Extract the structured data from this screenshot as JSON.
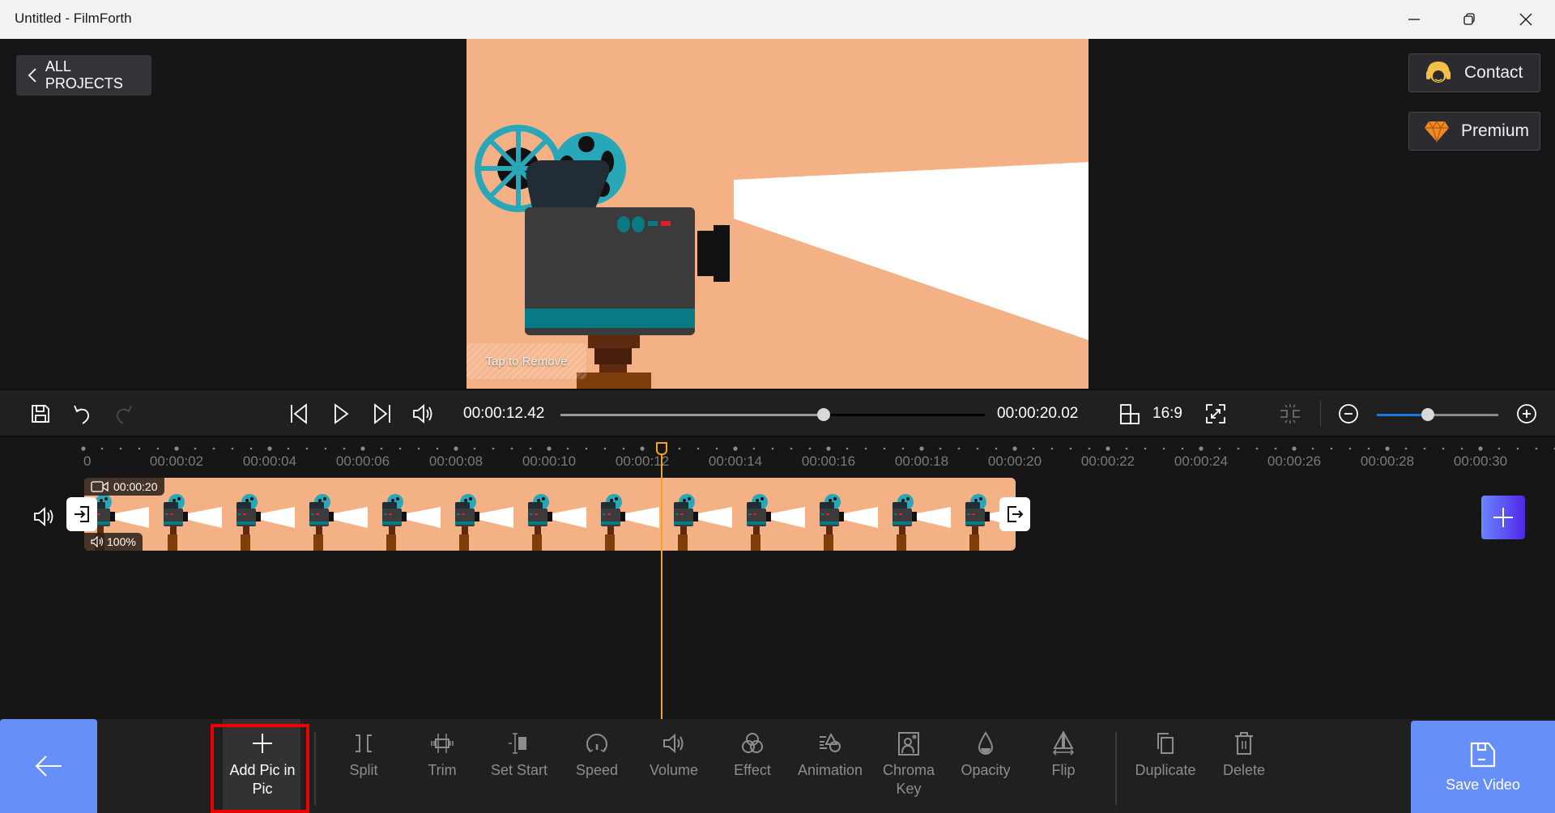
{
  "window": {
    "title": "Untitled - FilmForth",
    "controls": [
      "minimize-icon",
      "restore-icon",
      "close-icon"
    ]
  },
  "header": {
    "all_projects_label": "ALL PROJECTS",
    "contact_label": "Contact",
    "premium_label": "Premium"
  },
  "preview": {
    "overlay_label": "Tap to Remove",
    "colors": {
      "background": "#f4b185",
      "reel": "#27a7b8",
      "body": "#3b3b3b",
      "stripe": "#087a84",
      "stand": "#7f3d0c",
      "beam": "#ffffff"
    }
  },
  "playback": {
    "current_time": "00:00:12.42",
    "total_time": "00:00:20.02",
    "progress_fraction": 0.62,
    "aspect_ratio": "16:9",
    "timeline_zoom_fraction": 0.42,
    "icons": [
      "save-icon",
      "undo-icon",
      "redo-icon",
      "skip-back-icon",
      "play-icon",
      "skip-forward-icon",
      "volume-icon",
      "aspect-ratio-icon",
      "fullscreen-icon",
      "snap-icon",
      "zoom-out-icon",
      "zoom-in-icon"
    ]
  },
  "timeline": {
    "ticks": [
      "0",
      "00:00:02",
      "00:00:04",
      "00:00:06",
      "00:00:08",
      "00:00:10",
      "00:00:12",
      "00:00:14",
      "00:00:16",
      "00:00:18",
      "00:00:20",
      "00:00:22",
      "00:00:24",
      "00:00:26",
      "00:00:28",
      "00:00:30"
    ],
    "playhead_seconds": 12.42,
    "clip": {
      "duration": "00:00:20",
      "volume": "100%",
      "thumbnail_count": 13
    }
  },
  "toolbar": {
    "tools": [
      {
        "id": "add-pic-in-pic",
        "label": "Add Pic in Pic",
        "icon": "plus-icon",
        "active": true,
        "highlighted": true
      },
      {
        "id": "split",
        "label": "Split",
        "icon": "split-icon"
      },
      {
        "id": "trim",
        "label": "Trim",
        "icon": "trim-icon"
      },
      {
        "id": "set-start",
        "label": "Set Start",
        "icon": "set-start-icon"
      },
      {
        "id": "speed",
        "label": "Speed",
        "icon": "speedometer-icon"
      },
      {
        "id": "volume",
        "label": "Volume",
        "icon": "volume-icon"
      },
      {
        "id": "effect",
        "label": "Effect",
        "icon": "effect-icon"
      },
      {
        "id": "animation",
        "label": "Animation",
        "icon": "animation-icon"
      },
      {
        "id": "chroma-key",
        "label": "Chroma Key",
        "icon": "chroma-key-icon"
      },
      {
        "id": "opacity",
        "label": "Opacity",
        "icon": "droplet-icon"
      },
      {
        "id": "flip",
        "label": "Flip",
        "icon": "flip-icon"
      },
      {
        "id": "duplicate",
        "label": "Duplicate",
        "icon": "duplicate-icon"
      },
      {
        "id": "delete",
        "label": "Delete",
        "icon": "trash-icon"
      }
    ],
    "save_video_label": "Save Video",
    "accent_color": "#6690f8"
  }
}
